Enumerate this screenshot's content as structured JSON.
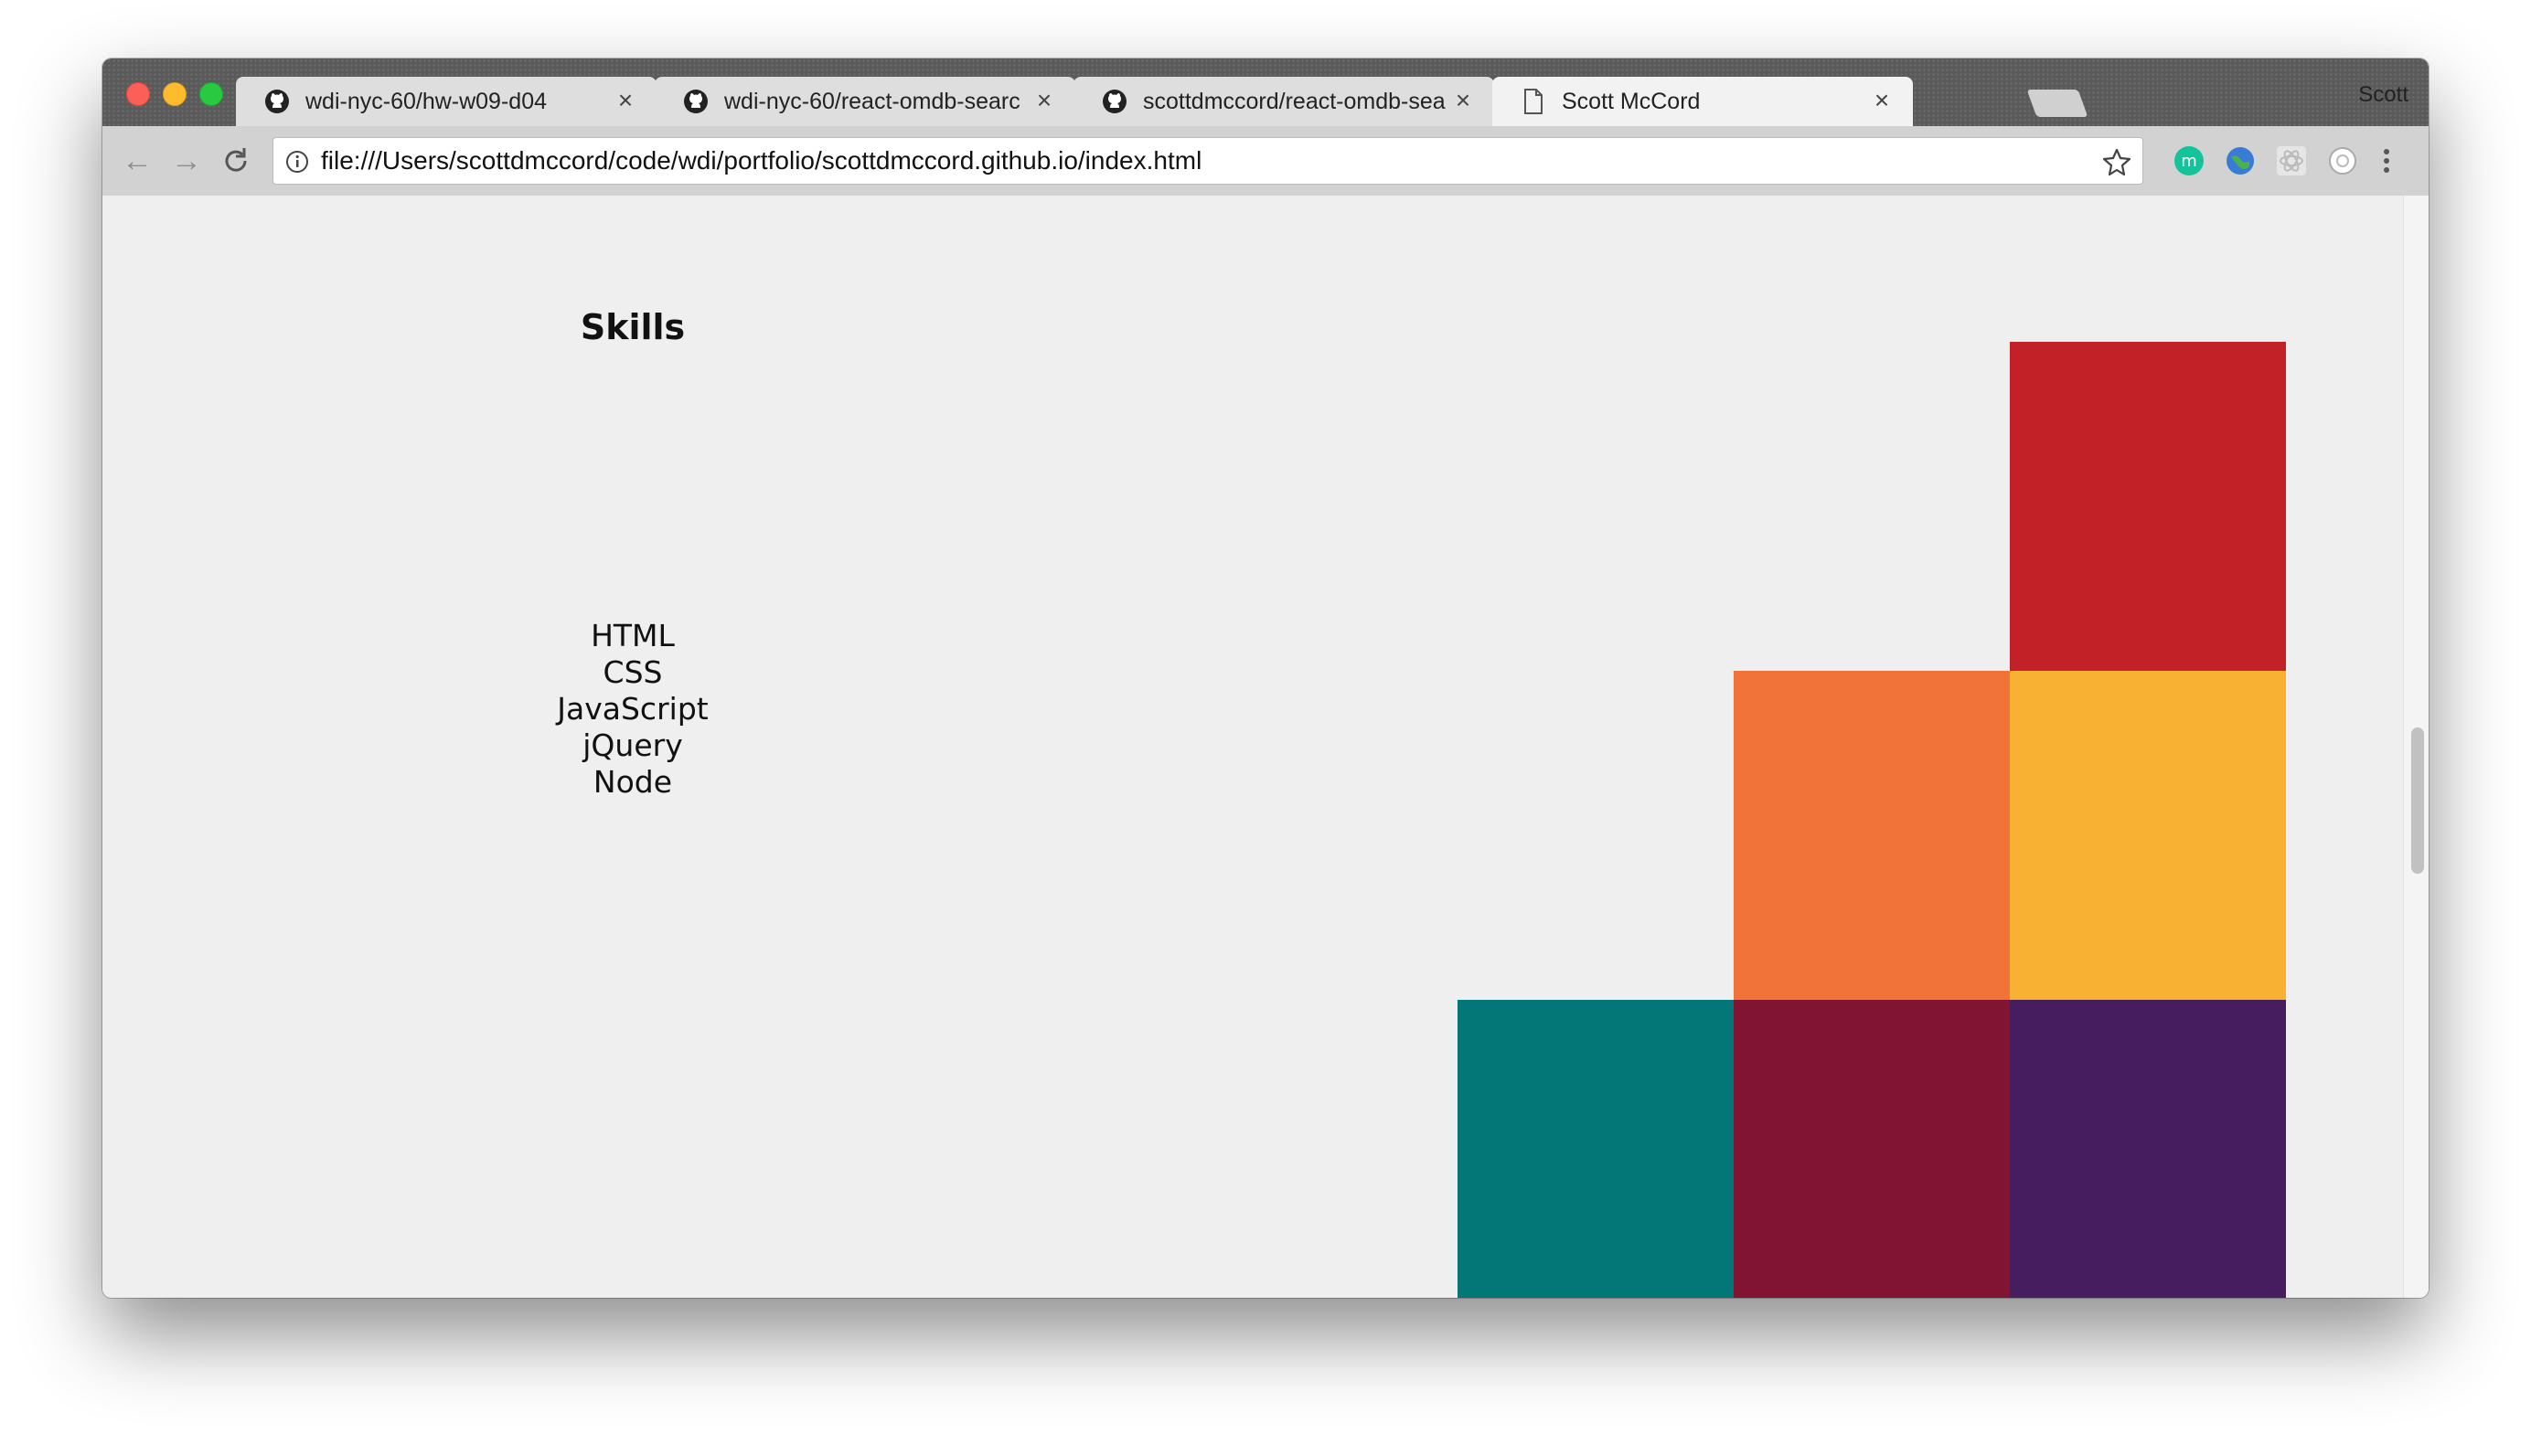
{
  "browser": {
    "tabs": [
      {
        "label": "wdi-nyc-60/hw-w09-d04",
        "icon": "github-icon",
        "active": false
      },
      {
        "label": "wdi-nyc-60/react-omdb-searc",
        "icon": "github-icon",
        "active": false
      },
      {
        "label": "scottdmccord/react-omdb-sea",
        "icon": "github-icon",
        "active": false
      },
      {
        "label": "Scott McCord",
        "icon": "document-icon",
        "active": true
      }
    ],
    "profile_name": "Scott",
    "url": "file:///Users/scottdmccord/code/wdi/portfolio/scottdmccord.github.io/index.html",
    "extensions": [
      "grammarly-icon",
      "globe-icon",
      "react-devtools-icon",
      "circle-extension-icon"
    ]
  },
  "page": {
    "skills_title": "Skills",
    "skills": [
      "HTML",
      "CSS",
      "JavaScript",
      "jQuery",
      "Node"
    ],
    "color_blocks": [
      {
        "name": "red",
        "color": "#c12127"
      },
      {
        "name": "orange",
        "color": "#f27339"
      },
      {
        "name": "yellow",
        "color": "#f9b134"
      },
      {
        "name": "teal",
        "color": "#037778"
      },
      {
        "name": "maroon",
        "color": "#821433"
      },
      {
        "name": "purple",
        "color": "#461e5f"
      }
    ]
  }
}
